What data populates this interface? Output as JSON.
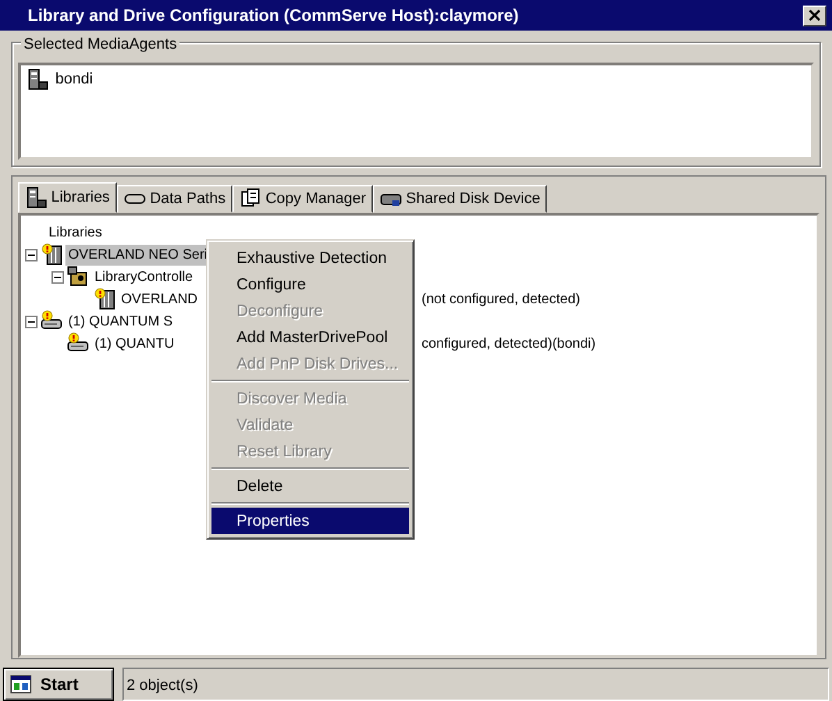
{
  "window": {
    "title": "Library and Drive Configuration (CommServe Host):claymore)"
  },
  "media_agents": {
    "label": "Selected MediaAgents",
    "items": [
      {
        "name": "bondi",
        "selected": false
      }
    ]
  },
  "tabs": [
    {
      "label": "Libraries",
      "kind": "library",
      "selected": true
    },
    {
      "label": "Data Paths",
      "kind": "path",
      "selected": false
    },
    {
      "label": "Copy Manager",
      "kind": "copy",
      "selected": false
    },
    {
      "label": "Shared Disk Device",
      "kind": "disk",
      "selected": false
    }
  ],
  "tree": {
    "root_label": "Libraries",
    "nodes": [
      {
        "label": "OVERLAND NEO Seri",
        "kind": "library",
        "expanded": true,
        "selected": true,
        "children": [
          {
            "label": "LibraryControlle",
            "kind": "controller",
            "expanded": true,
            "selected": false,
            "children": [
              {
                "label": "OVERLAND",
                "kind": "library",
                "selected": false,
                "suffix": "(not configured, detected)"
              }
            ]
          }
        ]
      },
      {
        "label": "(1) QUANTUM S",
        "kind": "drive",
        "expanded": true,
        "selected": false,
        "children": [
          {
            "label": "(1) QUANTU",
            "kind": "drive",
            "selected": false,
            "suffix": "configured, detected)(bondi)"
          }
        ]
      }
    ]
  },
  "context_menu": [
    {
      "kind": "item",
      "label": "Exhaustive Detection",
      "disabled": false,
      "selected": false
    },
    {
      "kind": "item",
      "label": "Configure",
      "disabled": false,
      "selected": false
    },
    {
      "kind": "item",
      "label": "Deconfigure",
      "disabled": true,
      "selected": false
    },
    {
      "kind": "item",
      "label": "Add MasterDrivePool",
      "disabled": false,
      "selected": false
    },
    {
      "kind": "item",
      "label": "Add PnP Disk Drives...",
      "disabled": true,
      "selected": false
    },
    {
      "kind": "separator"
    },
    {
      "kind": "item",
      "label": "Discover Media",
      "disabled": true,
      "selected": false
    },
    {
      "kind": "item",
      "label": "Validate",
      "disabled": true,
      "selected": false
    },
    {
      "kind": "item",
      "label": "Reset Library",
      "disabled": true,
      "selected": false
    },
    {
      "kind": "separator"
    },
    {
      "kind": "item",
      "label": "Delete",
      "disabled": false,
      "selected": false
    },
    {
      "kind": "separator"
    },
    {
      "kind": "item",
      "label": "Properties",
      "disabled": false,
      "selected": true
    }
  ],
  "status_bar": {
    "start_button": "Start",
    "text": "2 object(s)"
  }
}
